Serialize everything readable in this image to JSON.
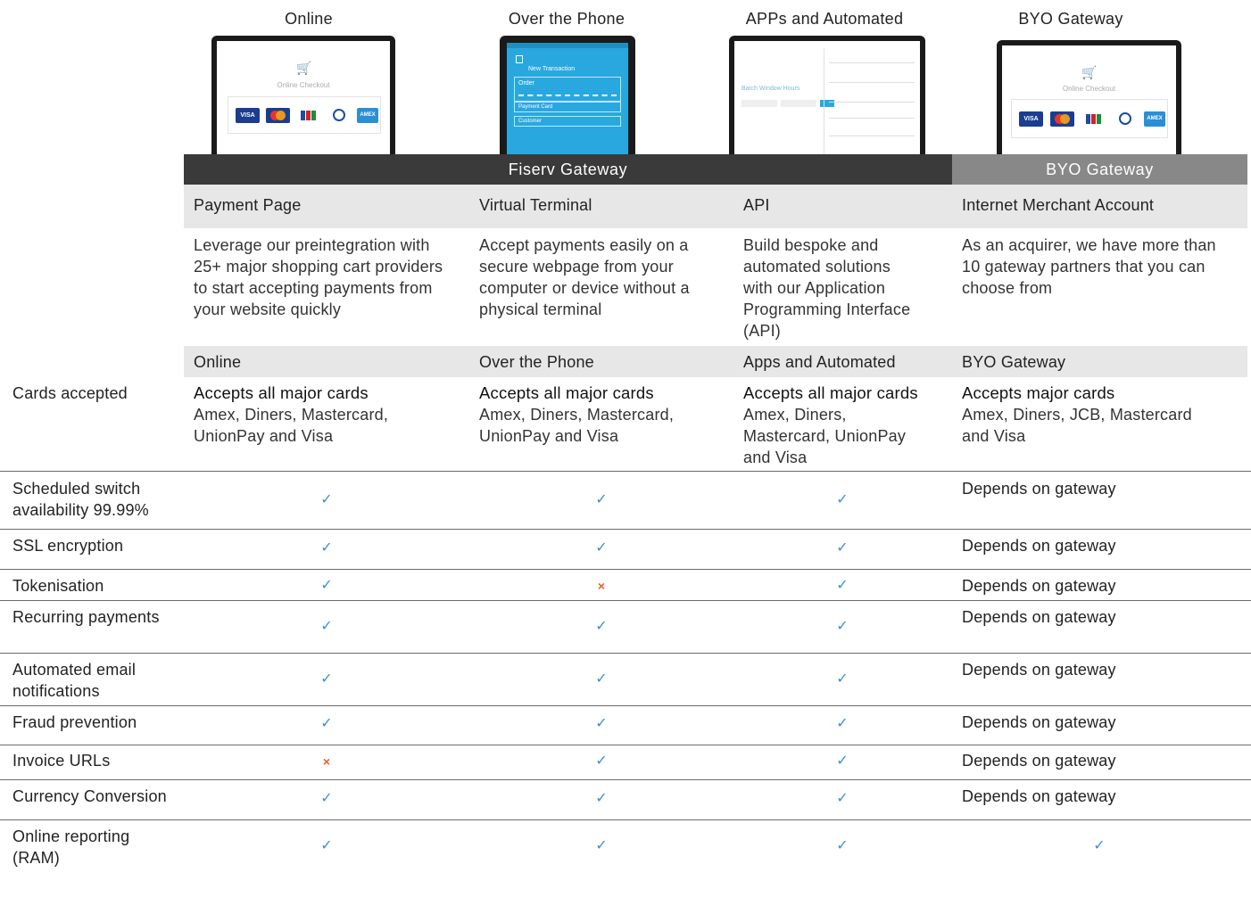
{
  "columns": {
    "online": "Online",
    "phone": "Over the Phone",
    "apps": "APPs and Automated",
    "byo": "BYO Gateway"
  },
  "screens": {
    "online_checkout": "Online Checkout",
    "phone_header": "New Transaction",
    "phone_order": "Order",
    "phone_payment_card": "Payment Card",
    "phone_customer": "Customer",
    "api_batch": "Batch Window Hours",
    "byo_checkout": "Online Checkout",
    "cards": [
      "VISA",
      "AMEX"
    ]
  },
  "bands": {
    "fiserv": "Fiserv Gateway",
    "byo": "BYO Gateway"
  },
  "products": [
    "Payment Page",
    "Virtual Terminal",
    "API",
    "Internet Merchant Account"
  ],
  "descriptions": [
    [
      "Leverage our preintegration with",
      "25+ major shopping cart providers",
      "to start accepting payments from",
      "your website quickly"
    ],
    [
      "Accept payments easily on a",
      "secure webpage from your",
      "computer or device without a",
      "physical terminal"
    ],
    [
      "Build bespoke and",
      "automated solutions",
      "with our Application",
      "Programming Interface",
      "(API)"
    ],
    [
      "As an acquirer, we have more than",
      "10 gateway partners that you can",
      "choose from"
    ]
  ],
  "channels": [
    "Online",
    "Over the Phone",
    "Apps and Automated",
    "BYO Gateway"
  ],
  "cards_accepted": {
    "label": "Cards accepted",
    "cols": [
      {
        "head": "Accepts all major cards",
        "lines": [
          "Amex, Diners, Mastercard,",
          "UnionPay and Visa"
        ]
      },
      {
        "head": "Accepts all major cards",
        "lines": [
          "Amex, Diners, Mastercard,",
          "UnionPay and Visa"
        ]
      },
      {
        "head": "Accepts all major cards",
        "lines": [
          "Amex, Diners,",
          "Mastercard, UnionPay",
          "and Visa"
        ]
      },
      {
        "head": "Accepts major cards",
        "lines": [
          "Amex, Diners, JCB, Mastercard",
          "and Visa"
        ]
      }
    ]
  },
  "features": [
    {
      "label": [
        "Scheduled switch",
        "availability 99.99%"
      ],
      "online": "yes",
      "phone": "yes",
      "apps": "yes",
      "byo": "Depends on gateway"
    },
    {
      "label": [
        "SSL encryption"
      ],
      "online": "yes",
      "phone": "yes",
      "apps": "yes",
      "byo": "Depends on gateway"
    },
    {
      "label": [
        "Tokenisation"
      ],
      "online": "yes",
      "phone": "no",
      "apps": "yes",
      "byo": "Depends on gateway"
    },
    {
      "label": [
        "Recurring payments"
      ],
      "online": "yes",
      "phone": "yes",
      "apps": "yes",
      "byo": "Depends on gateway"
    },
    {
      "label": [
        "Automated email",
        "notifications"
      ],
      "online": "yes",
      "phone": "yes",
      "apps": "yes",
      "byo": "Depends on gateway"
    },
    {
      "label": [
        "Fraud prevention"
      ],
      "online": "yes",
      "phone": "yes",
      "apps": "yes",
      "byo": "Depends on gateway"
    },
    {
      "label": [
        "Invoice URLs"
      ],
      "online": "no",
      "phone": "yes",
      "apps": "yes",
      "byo": "Depends on gateway"
    },
    {
      "label": [
        "Currency Conversion"
      ],
      "online": "yes",
      "phone": "yes",
      "apps": "yes",
      "byo": "Depends on gateway"
    },
    {
      "label": [
        "Online reporting",
        "(RAM)"
      ],
      "online": "yes",
      "phone": "yes",
      "apps": "yes",
      "byo": "yes"
    }
  ],
  "symbols": {
    "yes": "✓",
    "no": "×"
  },
  "colors": {
    "tick": "#3b8fd3",
    "cross": "#e4602a",
    "dark_band": "#3a3a3a",
    "grey_band": "#888888",
    "light_row": "#e7e7e8",
    "phone_screen": "#29a8e0"
  }
}
